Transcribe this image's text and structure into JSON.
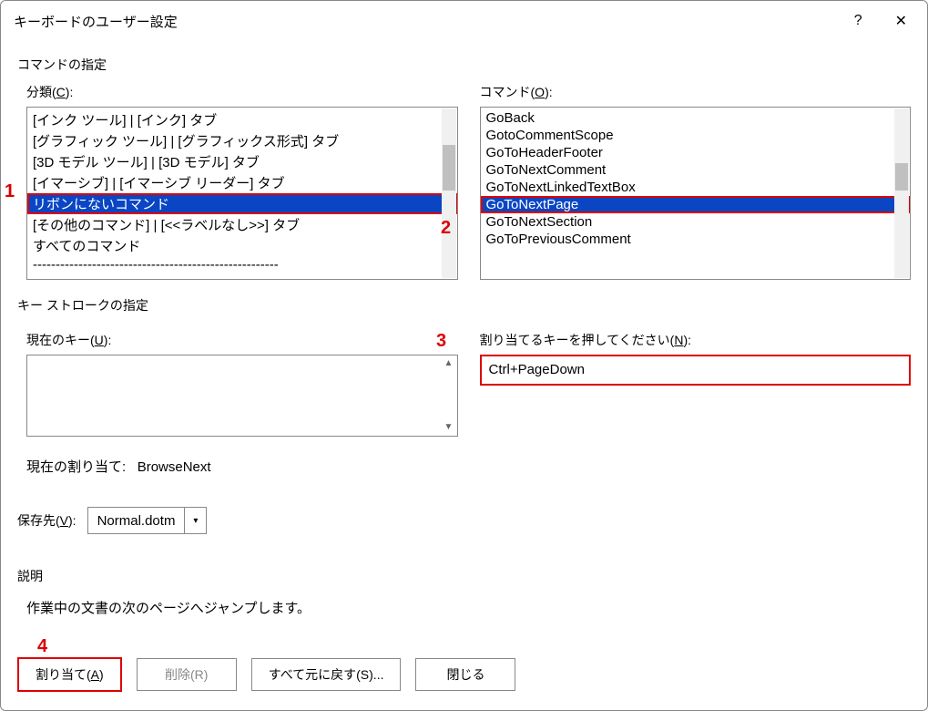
{
  "title": "キーボードのユーザー設定",
  "help_symbol": "?",
  "close_symbol": "✕",
  "section_command": "コマンドの指定",
  "categories_label_pre": "分類(",
  "categories_label_key": "C",
  "categories_label_post": "):",
  "categories": [
    "[インク ツール] | [インク] タブ",
    "[グラフィック ツール] | [グラフィックス形式] タブ",
    "[3D モデル ツール] | [3D モデル] タブ",
    "[イマーシブ] | [イマーシブ リーダー] タブ",
    "リボンにないコマンド",
    "[その他のコマンド] | [<<ラベルなし>>] タブ",
    "すべてのコマンド",
    "------------------------------------------------------"
  ],
  "categories_selected_index": 4,
  "commands_label_pre": "コマンド(",
  "commands_label_key": "O",
  "commands_label_post": "):",
  "commands": [
    "GoBack",
    "GotoCommentScope",
    "GoToHeaderFooter",
    "GoToNextComment",
    "GoToNextLinkedTextBox",
    "GoToNextPage",
    "GoToNextSection",
    "GoToPreviousComment"
  ],
  "commands_selected_index": 5,
  "section_keys": "キー ストロークの指定",
  "current_keys_label_pre": "現在のキー(",
  "current_keys_label_key": "U",
  "current_keys_label_post": "):",
  "press_key_label_pre": "割り当てるキーを押してください(",
  "press_key_label_key": "N",
  "press_key_label_post": "):",
  "press_key_value": "Ctrl+PageDown",
  "current_assign_label": "現在の割り当て:",
  "current_assign_value": "BrowseNext",
  "save_label_pre": "保存先(",
  "save_label_key": "V",
  "save_label_post": "):",
  "save_value": "Normal.dotm",
  "desc_label": "説明",
  "desc_text": "作業中の文書の次のページへジャンプします。",
  "btn_assign_pre": "割り当て(",
  "btn_assign_key": "A",
  "btn_assign_post": ")",
  "btn_remove": "削除(R)",
  "btn_reset": "すべて元に戻す(S)...",
  "btn_close": "閉じる",
  "annotations": {
    "a1": "1",
    "a2": "2",
    "a3": "3",
    "a4": "4"
  }
}
